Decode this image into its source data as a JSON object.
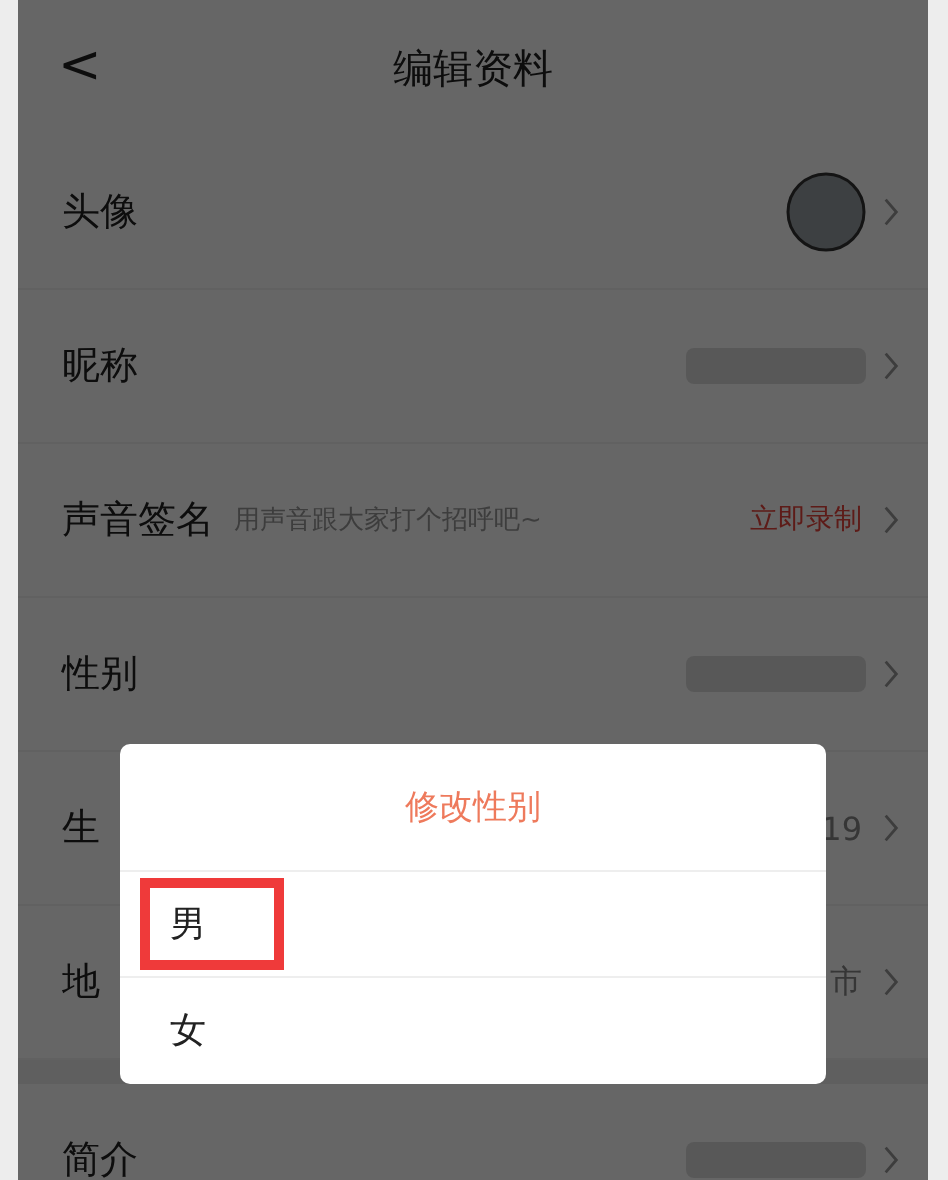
{
  "header": {
    "back": "<",
    "title": "编辑资料"
  },
  "rows": [
    {
      "kind": "avatar",
      "label": "头像"
    },
    {
      "kind": "blurred",
      "label": "昵称"
    },
    {
      "kind": "voice",
      "label": "声音签名",
      "hint": "用声音跟大家打个招呼吧~",
      "action": "立即录制"
    },
    {
      "kind": "blurred",
      "label": "性别"
    },
    {
      "kind": "text",
      "label": "生",
      "value": "19"
    },
    {
      "kind": "text",
      "label": "地",
      "value": "市"
    },
    {
      "kind": "section-gap"
    },
    {
      "kind": "blurred",
      "label": "简介"
    }
  ],
  "dialog": {
    "title": "修改性别",
    "options": [
      {
        "label": "男",
        "highlighted": true
      },
      {
        "label": "女",
        "highlighted": false
      }
    ]
  }
}
